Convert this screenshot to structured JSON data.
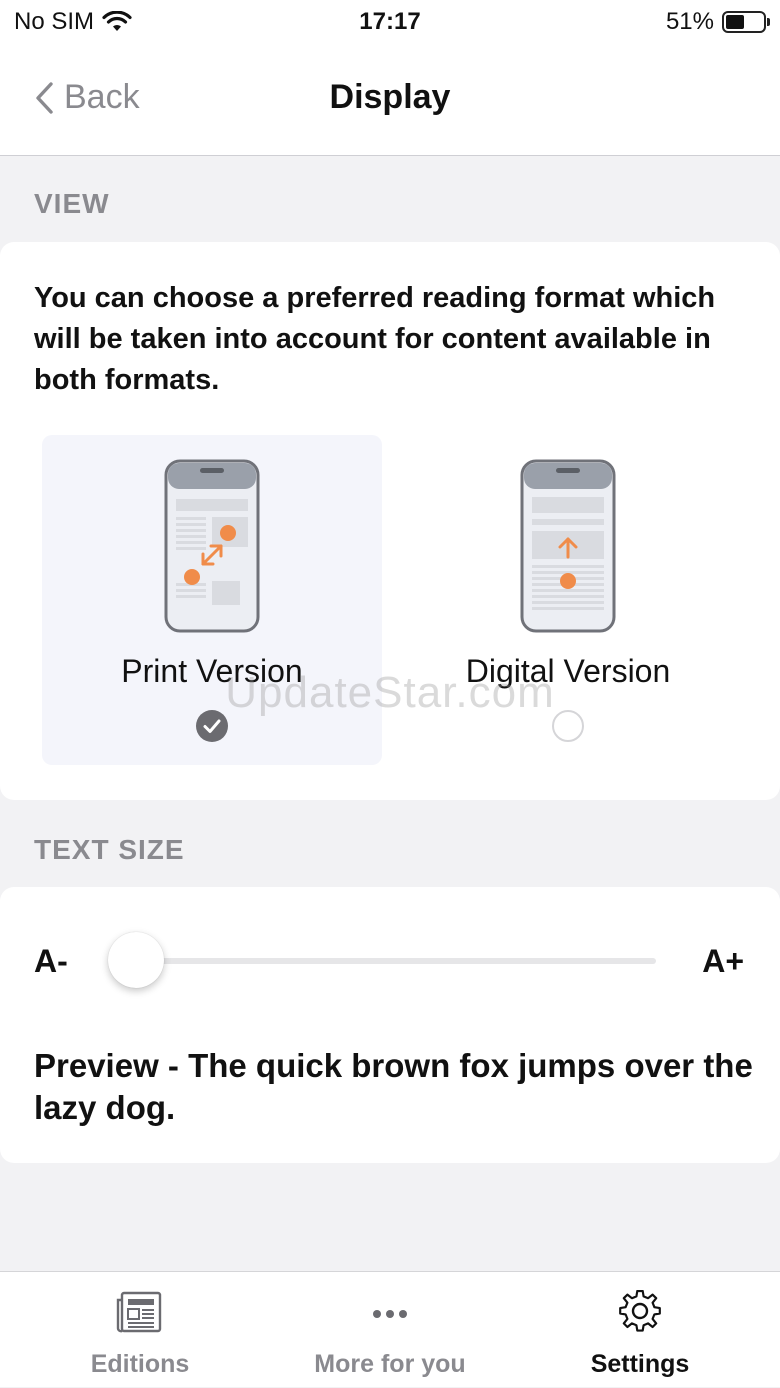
{
  "status_bar": {
    "carrier": "No SIM",
    "time": "17:17",
    "battery_percent": "51%",
    "battery_level": 0.51
  },
  "nav": {
    "back_label": "Back",
    "title": "Display"
  },
  "view_section": {
    "header": "VIEW",
    "description": "You can choose a preferred reading format which will be taken into account for content available in both formats.",
    "options": [
      {
        "label": "Print Version",
        "selected": true,
        "icon": "print-version-phone-icon"
      },
      {
        "label": "Digital Version",
        "selected": false,
        "icon": "digital-version-phone-icon"
      }
    ]
  },
  "text_size_section": {
    "header": "TEXT SIZE",
    "decrease_label": "A-",
    "increase_label": "A+",
    "slider_value": 0,
    "preview": "Preview - The quick brown fox jumps over the lazy dog."
  },
  "watermark": "UpdateStar.com",
  "tab_bar": {
    "tabs": [
      {
        "label": "Editions",
        "icon": "newspaper-icon",
        "active": false
      },
      {
        "label": "More for you",
        "icon": "more-dots-icon",
        "active": false
      },
      {
        "label": "Settings",
        "icon": "gear-icon",
        "active": true
      }
    ]
  },
  "colors": {
    "accent": "#f08c4a",
    "background": "#f2f2f4",
    "muted_text": "#8a8a8f",
    "selected_option_bg": "#f4f5fb"
  }
}
